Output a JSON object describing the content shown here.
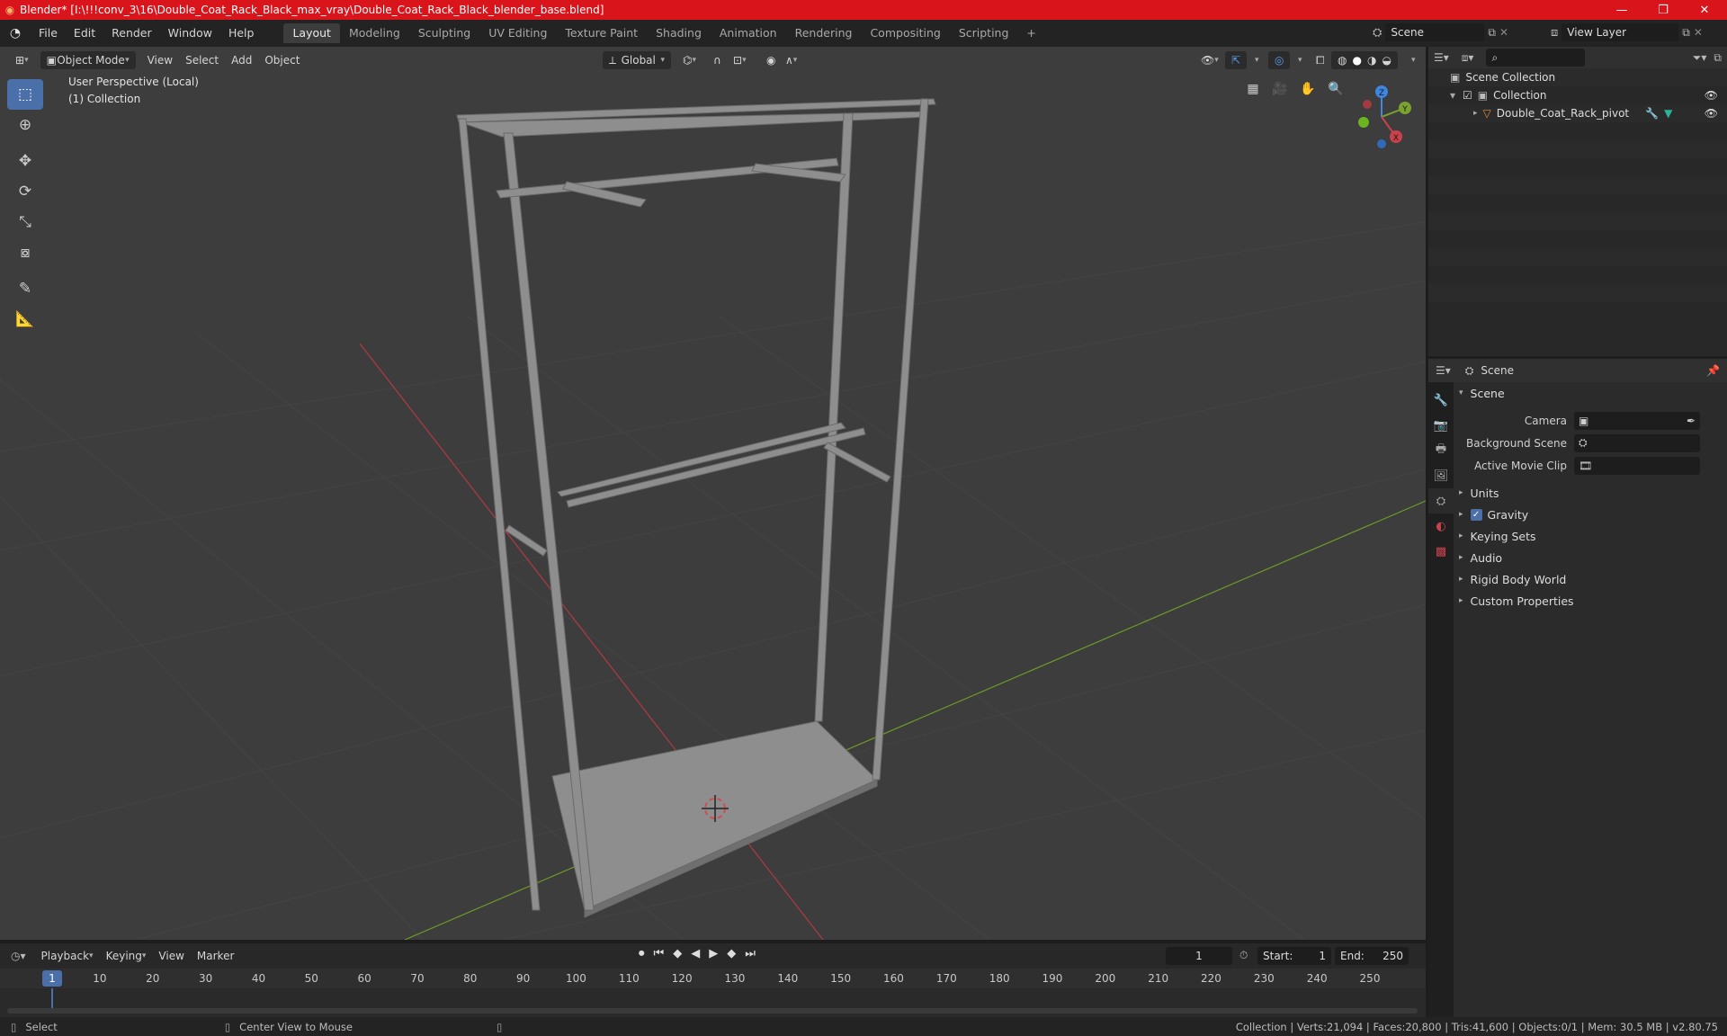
{
  "titlebar": {
    "title": "Blender* [I:\\!!!conv_3\\16\\Double_Coat_Rack_Black_max_vray\\Double_Coat_Rack_Black_blender_base.blend]",
    "minimize": "—",
    "maximize": "❐",
    "close": "✕"
  },
  "menu": {
    "file": "File",
    "edit": "Edit",
    "render": "Render",
    "window": "Window",
    "help": "Help"
  },
  "workspaces": [
    "Layout",
    "Modeling",
    "Sculpting",
    "UV Editing",
    "Texture Paint",
    "Shading",
    "Animation",
    "Rendering",
    "Compositing",
    "Scripting"
  ],
  "workspace_add": "+",
  "scene": {
    "label": "Scene",
    "view_layer": "View Layer"
  },
  "viewport": {
    "mode": "Object Mode",
    "view": "View",
    "select": "Select",
    "add": "Add",
    "object": "Object",
    "orientation": "Global",
    "perspective": "User Perspective (Local)",
    "collection": "(1) Collection",
    "gizmo": {
      "z": "Z",
      "y": "Y",
      "x": "X"
    }
  },
  "outliner": {
    "root": "Scene Collection",
    "collection": "Collection",
    "object": "Double_Coat_Rack_pivot"
  },
  "properties": {
    "context": "Scene",
    "panel": "Scene",
    "camera_label": "Camera",
    "bg_scene_label": "Background Scene",
    "movie_clip_label": "Active Movie Clip",
    "sections": [
      "Units",
      "Gravity",
      "Keying Sets",
      "Audio",
      "Rigid Body World",
      "Custom Properties"
    ],
    "gravity_checked": true
  },
  "timeline": {
    "playback": "Playback",
    "keying": "Keying",
    "view": "View",
    "marker": "Marker",
    "current_frame": "1",
    "start_label": "Start:",
    "start": "1",
    "end_label": "End:",
    "end": "250",
    "ruler": [
      "1",
      "10",
      "20",
      "30",
      "40",
      "50",
      "60",
      "70",
      "80",
      "90",
      "100",
      "110",
      "120",
      "130",
      "140",
      "150",
      "160",
      "170",
      "180",
      "190",
      "200",
      "210",
      "220",
      "230",
      "240",
      "250"
    ]
  },
  "status": {
    "select": "Select",
    "center_view": "Center View to Mouse",
    "stats": "Collection | Verts:21,094 | Faces:20,800 | Tris:41,600 | Objects:0/1 | Mem: 30.5 MB | v2.80.75"
  },
  "colors": {
    "title_bar": "#d9141b",
    "accent": "#4b6fa8",
    "x_axis": "#c8424c",
    "y_axis": "#7ba130",
    "z_axis": "#3e86e0"
  }
}
